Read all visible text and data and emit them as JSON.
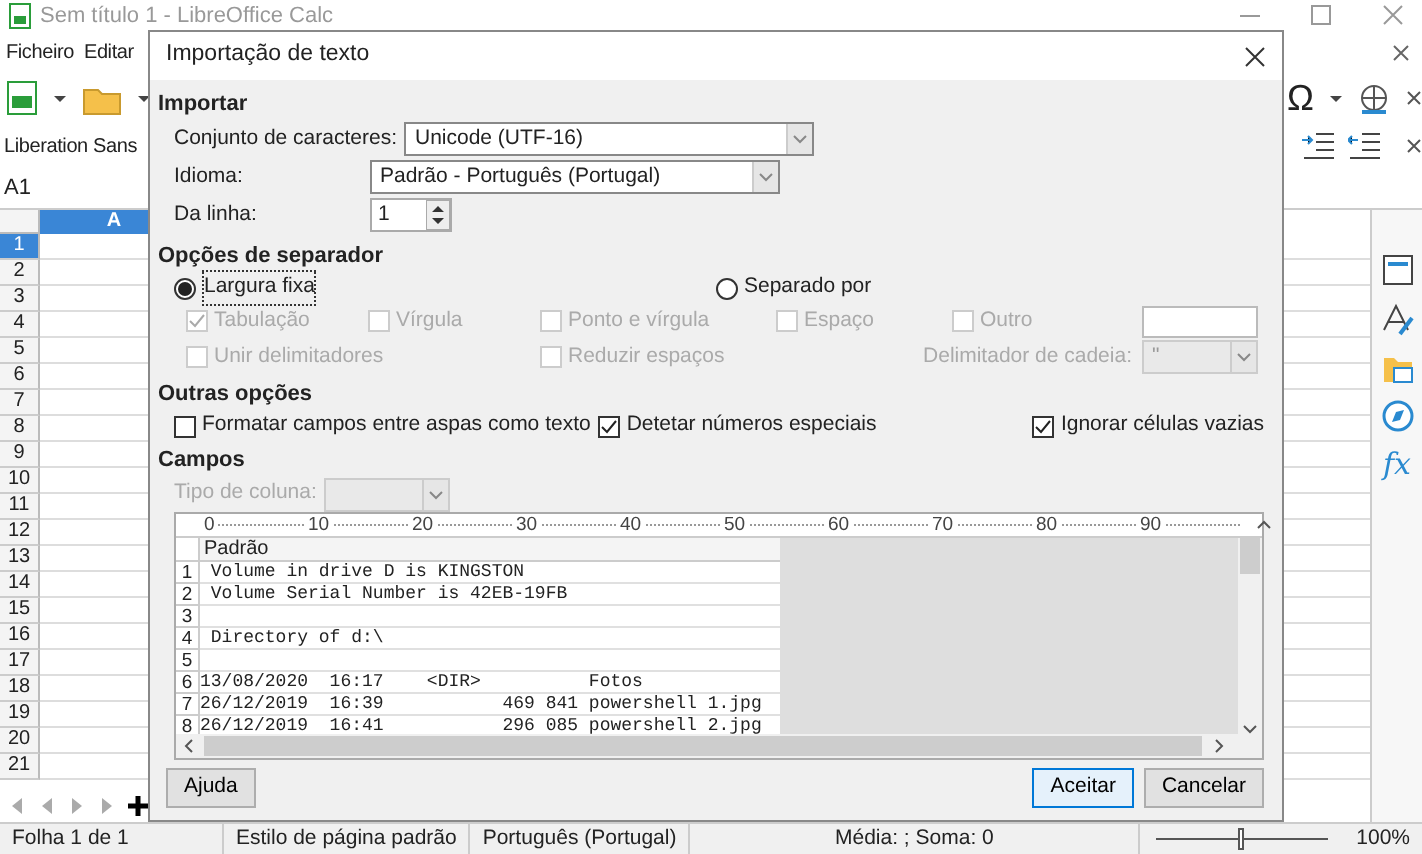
{
  "app": {
    "title": "Sem título 1 - LibreOffice Calc",
    "menu": [
      "Ficheiro",
      "Editar"
    ],
    "special_character_glyph": "Ω",
    "font_name": "Liberation Sans",
    "name_box": "A1",
    "columns": [
      {
        "label": "A",
        "selected": true
      }
    ],
    "rows": [
      {
        "label": "1",
        "selected": true
      },
      {
        "label": "2",
        "selected": false
      },
      {
        "label": "3",
        "selected": false
      },
      {
        "label": "4",
        "selected": false
      },
      {
        "label": "5",
        "selected": false
      },
      {
        "label": "6",
        "selected": false
      },
      {
        "label": "7",
        "selected": false
      },
      {
        "label": "8",
        "selected": false
      },
      {
        "label": "9",
        "selected": false
      },
      {
        "label": "10",
        "selected": false
      },
      {
        "label": "11",
        "selected": false
      },
      {
        "label": "12",
        "selected": false
      },
      {
        "label": "13",
        "selected": false
      },
      {
        "label": "14",
        "selected": false
      },
      {
        "label": "15",
        "selected": false
      },
      {
        "label": "16",
        "selected": false
      },
      {
        "label": "17",
        "selected": false
      },
      {
        "label": "18",
        "selected": false
      },
      {
        "label": "19",
        "selected": false
      },
      {
        "label": "20",
        "selected": false
      },
      {
        "label": "21",
        "selected": false
      }
    ],
    "sidebar_functions_glyph": "fx",
    "status_bar": {
      "sheet": "Folha 1 de 1",
      "page_style": "Estilo de página padrão",
      "language": "Português (Portugal)",
      "summary": "Média: ; Soma: 0",
      "zoom": {
        "level": 0.5,
        "reading": "100%"
      }
    }
  },
  "dialog": {
    "title": "Importação de texto",
    "import": {
      "title": "Importar",
      "charset": {
        "label": "Conjunto de caracteres:",
        "value": "Unicode (UTF-16)"
      },
      "language": {
        "label": "Idioma:",
        "value": "Padrão - Português (Portugal)"
      },
      "from_row": {
        "label": "Da linha:",
        "value": "1"
      }
    },
    "separator_options": {
      "title": "Opções de separador",
      "modes": [
        {
          "label": "Largura fixa",
          "selected": true
        },
        {
          "label": "Separado por",
          "selected": false
        }
      ],
      "separators": [
        {
          "label": "Tabulação",
          "checked": true,
          "disabled": true
        },
        {
          "label": "Vírgula",
          "checked": false,
          "disabled": true
        },
        {
          "label": "Ponto e vírgula",
          "checked": false,
          "disabled": true
        },
        {
          "label": "Espaço",
          "checked": false,
          "disabled": true
        },
        {
          "label": "Outro",
          "checked": false,
          "disabled": true
        }
      ],
      "merge": [
        {
          "label": "Unir delimitadores",
          "checked": false,
          "disabled": true
        },
        {
          "label": "Reduzir espaços",
          "checked": false,
          "disabled": true
        }
      ],
      "string_delimiter": {
        "label": "Delimitador de cadeia:",
        "value": "\"",
        "disabled": true
      }
    },
    "other_options": {
      "title": "Outras opções",
      "options": [
        {
          "label": "Formatar campos entre aspas como texto",
          "checked": false
        },
        {
          "label": "Detetar números especiais",
          "checked": true
        },
        {
          "label": "Ignorar células vazias",
          "checked": true
        }
      ]
    },
    "fields": {
      "title": "Campos",
      "column_type": {
        "label": "Tipo de coluna:",
        "disabled": true
      },
      "ruler": [
        "0",
        "10",
        "20",
        "30",
        "40",
        "50",
        "60",
        "70",
        "80",
        "90"
      ],
      "column_header": "Padrão",
      "lines": [
        {
          "number": "1",
          "text": " Volume in drive D is KINGSTON"
        },
        {
          "number": "2",
          "text": " Volume Serial Number is 42EB-19FB"
        },
        {
          "number": "3"
        },
        {
          "number": "4",
          "text": " Directory of d:\\"
        },
        {
          "number": "5"
        },
        {
          "number": "6",
          "text": "13/08/2020  16:17    <DIR>          Fotos"
        },
        {
          "number": "7",
          "text": "26/12/2019  16:39           469 841 powershell 1.jpg"
        },
        {
          "number": "8",
          "text": "26/12/2019  16:41           296 085 powershell 2.jpg"
        }
      ]
    },
    "buttons": [
      {
        "label": "Ajuda",
        "kind": "help"
      },
      {
        "label": "Aceitar",
        "kind": "default"
      },
      {
        "label": "Cancelar",
        "kind": "normal"
      }
    ]
  }
}
